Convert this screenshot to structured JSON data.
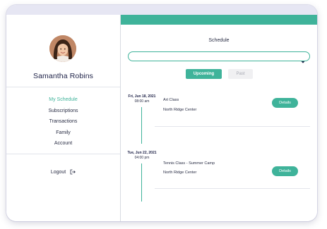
{
  "profile": {
    "name": "Samantha Robins"
  },
  "nav": {
    "items": [
      {
        "label": "My Schedule",
        "active": true
      },
      {
        "label": "Subscriptions",
        "active": false
      },
      {
        "label": "Transactions",
        "active": false
      },
      {
        "label": "Family",
        "active": false
      },
      {
        "label": "Account",
        "active": false
      }
    ],
    "logout_label": "Logout",
    "logout_icon": "logout-icon"
  },
  "schedule": {
    "title": "Schedule",
    "select": {
      "value": "",
      "icon": "chevron-down-icon"
    },
    "tabs": {
      "upcoming": "Upcoming",
      "past": "Past",
      "active": "upcoming"
    },
    "events": [
      {
        "date": "Fri, Jun 18, 2021",
        "time": "08:00 am",
        "title": "Art Class",
        "location": "North Ridge Center",
        "details_label": "Details"
      },
      {
        "date": "Tue, Jun 22, 2021",
        "time": "04:00 pm",
        "title": "Tennis Class - Summer Camp",
        "location": "North Ridge Center",
        "details_label": "Details"
      }
    ]
  },
  "colors": {
    "accent": "#3fb39a",
    "text_dark": "#1d2147",
    "inactive_tab_bg": "#f0f0f2",
    "top_bar": "#e6e6f3"
  }
}
